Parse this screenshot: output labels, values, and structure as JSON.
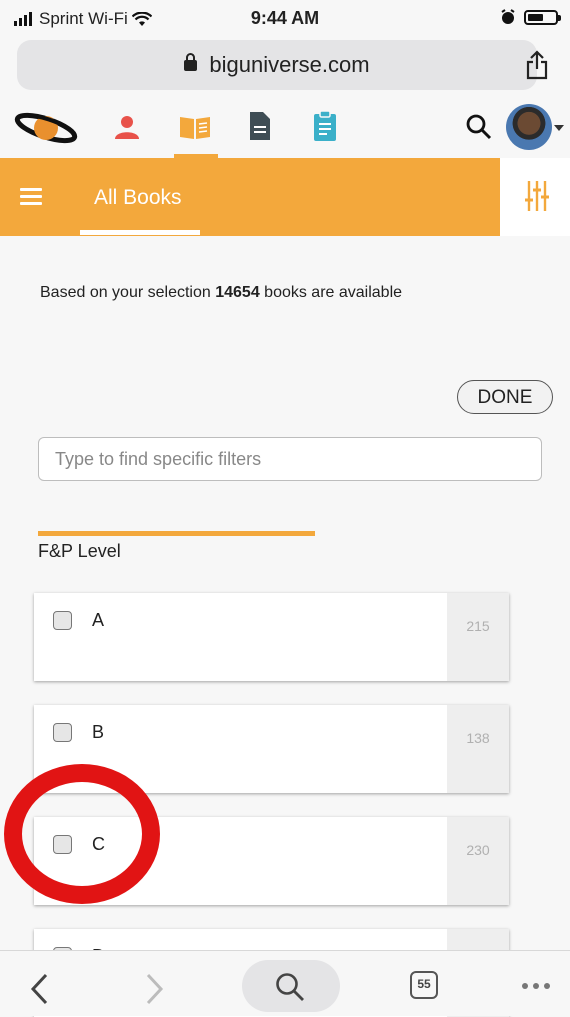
{
  "status_bar": {
    "carrier": "Sprint Wi-Fi",
    "time": "9:44 AM"
  },
  "browser": {
    "url": "biguniverse.com"
  },
  "app_nav": {
    "icons": [
      "planet-logo-icon",
      "person-icon",
      "book-icon",
      "document-icon",
      "clipboard-icon",
      "search-icon",
      "avatar"
    ],
    "active": "book-icon"
  },
  "header": {
    "title": "All Books"
  },
  "results": {
    "prefix": "Based on your selection ",
    "count": "14654",
    "suffix": " books are available"
  },
  "done_label": "DONE",
  "filter_search": {
    "placeholder": "Type to find specific filters"
  },
  "section": {
    "title": "F&P Level"
  },
  "levels": [
    {
      "label": "A",
      "count": "215"
    },
    {
      "label": "B",
      "count": "138"
    },
    {
      "label": "C",
      "count": "230"
    },
    {
      "label": "D",
      "count": ""
    }
  ],
  "toolbar": {
    "tab_count": "55"
  },
  "colors": {
    "accent": "#f3a83c",
    "highlight": "#e11414"
  }
}
